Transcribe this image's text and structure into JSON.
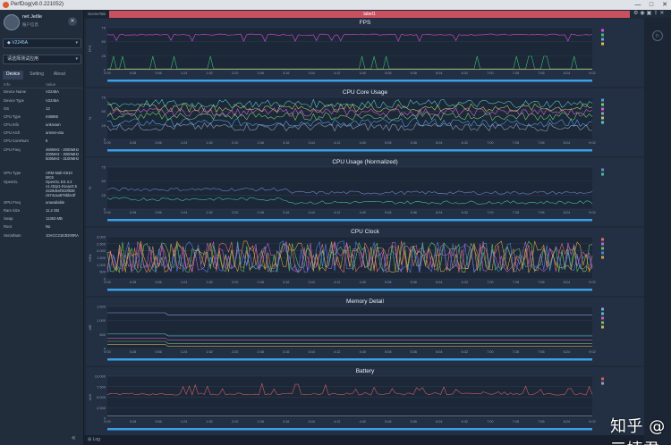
{
  "window": {
    "title": "PerfDog(v8.0.221052)",
    "controls": [
      "—",
      "□",
      "✕"
    ]
  },
  "user": {
    "name": "net Jetlle",
    "subtitle": "账户信息"
  },
  "device_selector": {
    "value": "V2245A"
  },
  "app_selector": {
    "placeholder": "请选择测试应用"
  },
  "sidebar_tabs": [
    "Device",
    "Setting",
    "About"
  ],
  "info_header": {
    "key": "Info",
    "value": "Value"
  },
  "device_info": [
    {
      "k": "Device Name",
      "v": "V2245A"
    },
    {
      "k": "Device Type",
      "v": "V2245A"
    },
    {
      "k": "OS",
      "v": "13"
    },
    {
      "k": "CPU Type",
      "v": "mt6895"
    },
    {
      "k": "CPU Info",
      "v": "unknown"
    },
    {
      "k": "CPU Arch",
      "v": "arm64-v8a"
    },
    {
      "k": "CPU CoreNum",
      "v": "8"
    },
    {
      "k": "CPU Freq",
      "v": "450MHz - 2000MHz\n200MHz - 3000MHz\n500MHz - 3100MHz"
    },
    {
      "k": "GPU Type",
      "v": "ARM Mali-G610\nMC6"
    },
    {
      "k": "OpenGL",
      "v": "OpenGL ES 3.2\nv1.r32p1-01eac0.5\n4229deef810f838\nc574caa875bbe3f"
    },
    {
      "k": "GPU Freq",
      "v": "unavailable"
    },
    {
      "k": "Ram Size",
      "v": "11.2 GB"
    },
    {
      "k": "Swap",
      "v": "11363 MB"
    },
    {
      "k": "Root",
      "v": "No"
    },
    {
      "k": "SerialNum",
      "v": "10ACC21E3D00RA"
    }
  ],
  "scene_tab": "SceneTab",
  "label_bar": "label1",
  "time_ticks": [
    "0:00",
    "0:28",
    "0:56",
    "1:24",
    "1:52",
    "2:20",
    "2:48",
    "3:16",
    "3:44",
    "4:12",
    "4:40",
    "5:08",
    "5:36",
    "6:04",
    "6:32",
    "7:00",
    "7:28",
    "7:56",
    "8:24",
    "9:02"
  ],
  "charts": [
    {
      "title": "FPS",
      "ylabel": "FPS",
      "yticks": [
        "75",
        "50",
        "25",
        "0"
      ],
      "colors": [
        "#d84fd8",
        "#3bbf6f",
        "#7a9fe0",
        "#e0c040"
      ]
    },
    {
      "title": "CPU Core Usage",
      "ylabel": "%",
      "yticks": [
        "75",
        "50",
        "25",
        "0"
      ],
      "colors": [
        "#4f9de0",
        "#6fd06f",
        "#d060d0",
        "#8fa0b8",
        "#c0c060",
        "#50c8c8"
      ]
    },
    {
      "title": "CPU Usage (Normalized)",
      "ylabel": "%",
      "yticks": [
        "75",
        "50",
        "25",
        "0"
      ],
      "colors": [
        "#6e87c8",
        "#40c0a0"
      ]
    },
    {
      "title": "CPU Clock",
      "ylabel": "MHz",
      "yticks": [
        "3,000",
        "2,500",
        "2,000",
        "1,500",
        "1,000",
        "500",
        "0"
      ],
      "colors": [
        "#e07070",
        "#c060d0",
        "#60c060",
        "#5080e0",
        "#d0a040"
      ]
    },
    {
      "title": "Memory Detail",
      "ylabel": "MB",
      "yticks": [
        "1,500",
        "1,000",
        "500",
        "0"
      ],
      "colors": [
        "#7fa8e6",
        "#50c0c0",
        "#c060c0",
        "#70c070",
        "#d0b050"
      ]
    },
    {
      "title": "Battery",
      "ylabel": "mW",
      "yticks": [
        "10,000",
        "7,500",
        "5,000",
        "2,500",
        "0"
      ],
      "colors": [
        "#d06060",
        "#8fa0b8"
      ]
    }
  ],
  "log_label": "Log",
  "watermark": "知乎 @三姨君",
  "side_button": "▷"
}
